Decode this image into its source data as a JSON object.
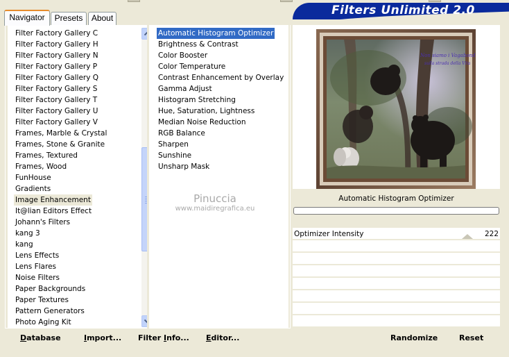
{
  "tabs": [
    {
      "label": "Navigator",
      "active": true
    },
    {
      "label": "Presets",
      "active": false
    },
    {
      "label": "About",
      "active": false
    }
  ],
  "banner": {
    "title": "Filters Unlimited 2.0",
    "color": "#0a2a9c"
  },
  "categories": {
    "items": [
      "Filter Factory Gallery C",
      "Filter Factory Gallery H",
      "Filter Factory Gallery N",
      "Filter Factory Gallery P",
      "Filter Factory Gallery Q",
      "Filter Factory Gallery S",
      "Filter Factory Gallery T",
      "Filter Factory Gallery U",
      "Filter Factory Gallery V",
      "Frames, Marble & Crystal",
      "Frames, Stone & Granite",
      "Frames, Textured",
      "Frames, Wood",
      "FunHouse",
      "Gradients",
      "Image Enhancement",
      "It@lian Editors Effect",
      "Johann's Filters",
      "kang 3",
      "kang",
      "Lens Effects",
      "Lens Flares",
      "Noise Filters",
      "Paper Backgrounds",
      "Paper Textures",
      "Pattern Generators",
      "Photo Aging Kit"
    ],
    "selected": "Image Enhancement"
  },
  "filters": {
    "items": [
      "Automatic Histogram Optimizer",
      "Brightness & Contrast",
      "Color Booster",
      "Color Temperature",
      "Contrast Enhancement by Overlay",
      "Gamma Adjust",
      "Histogram Stretching",
      "Hue, Saturation, Lightness",
      "Median Noise Reduction",
      "RGB Balance",
      "Sharpen",
      "Sunshine",
      "Unsharp Mask"
    ],
    "selected": "Automatic Histogram Optimizer"
  },
  "watermark": {
    "name": "Pinuccia",
    "site": "www.maidiregrafica.eu"
  },
  "preview": {
    "filter_name": "Automatic Histogram Optimizer",
    "image_text_line1": "Non siamo i Vagabondi",
    "image_text_line2": "sulla strada della Vita"
  },
  "controls": [
    {
      "label": "Optimizer Intensity",
      "value": "222",
      "level_max": 255
    }
  ],
  "bottom_left_buttons": [
    {
      "pre": "",
      "ul": "D",
      "post": "atabase"
    },
    {
      "pre": "",
      "ul": "I",
      "post": "mport..."
    },
    {
      "pre": "Filter ",
      "ul": "I",
      "post": "nfo..."
    },
    {
      "pre": "",
      "ul": "E",
      "post": "ditor..."
    }
  ],
  "bottom_right_buttons": [
    {
      "label": "Randomize"
    },
    {
      "label": "Reset"
    }
  ],
  "colors": {
    "selection": "#316ac5",
    "tab_accent": "#e68b2c",
    "panel_bg": "#ece9d8"
  }
}
